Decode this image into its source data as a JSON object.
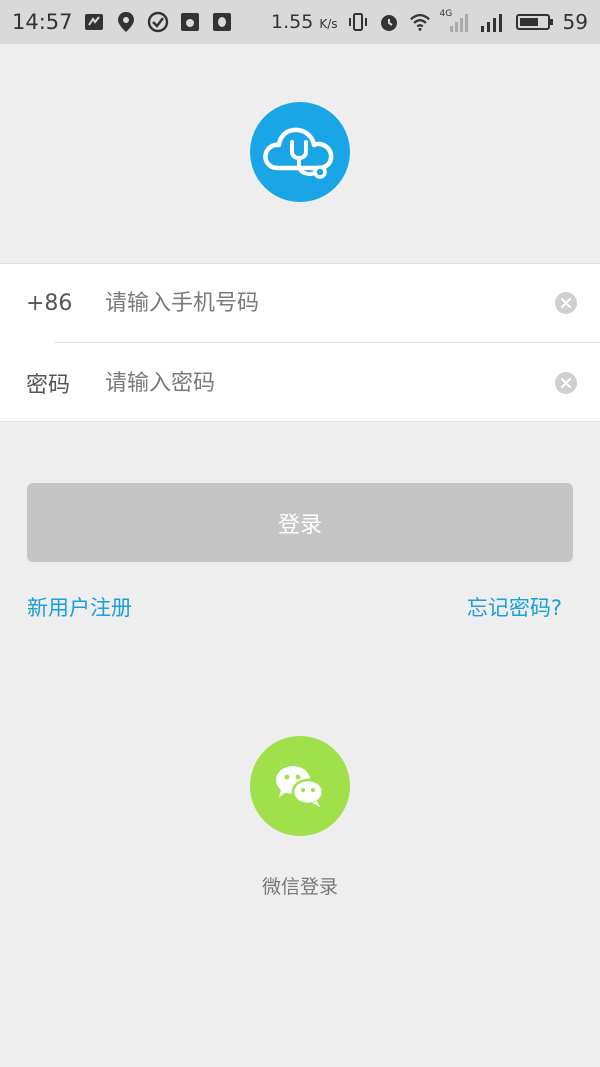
{
  "status_bar": {
    "time": "14:57",
    "network_speed": "1.55",
    "speed_unit": "K/s",
    "network_type": "4G",
    "battery_percent": "59"
  },
  "form": {
    "phone_prefix": "+86",
    "phone_placeholder": "请输入手机号码",
    "password_label": "密码",
    "password_placeholder": "请输入密码"
  },
  "login_button": "登录",
  "links": {
    "register": "新用户注册",
    "forgot": "忘记密码?"
  },
  "wechat": {
    "label": "微信登录"
  },
  "colors": {
    "brand_blue": "#1aa6e6",
    "link_blue": "#1a9fd9",
    "wechat_green": "#9fe04b",
    "button_disabled": "#c5c5c5"
  }
}
